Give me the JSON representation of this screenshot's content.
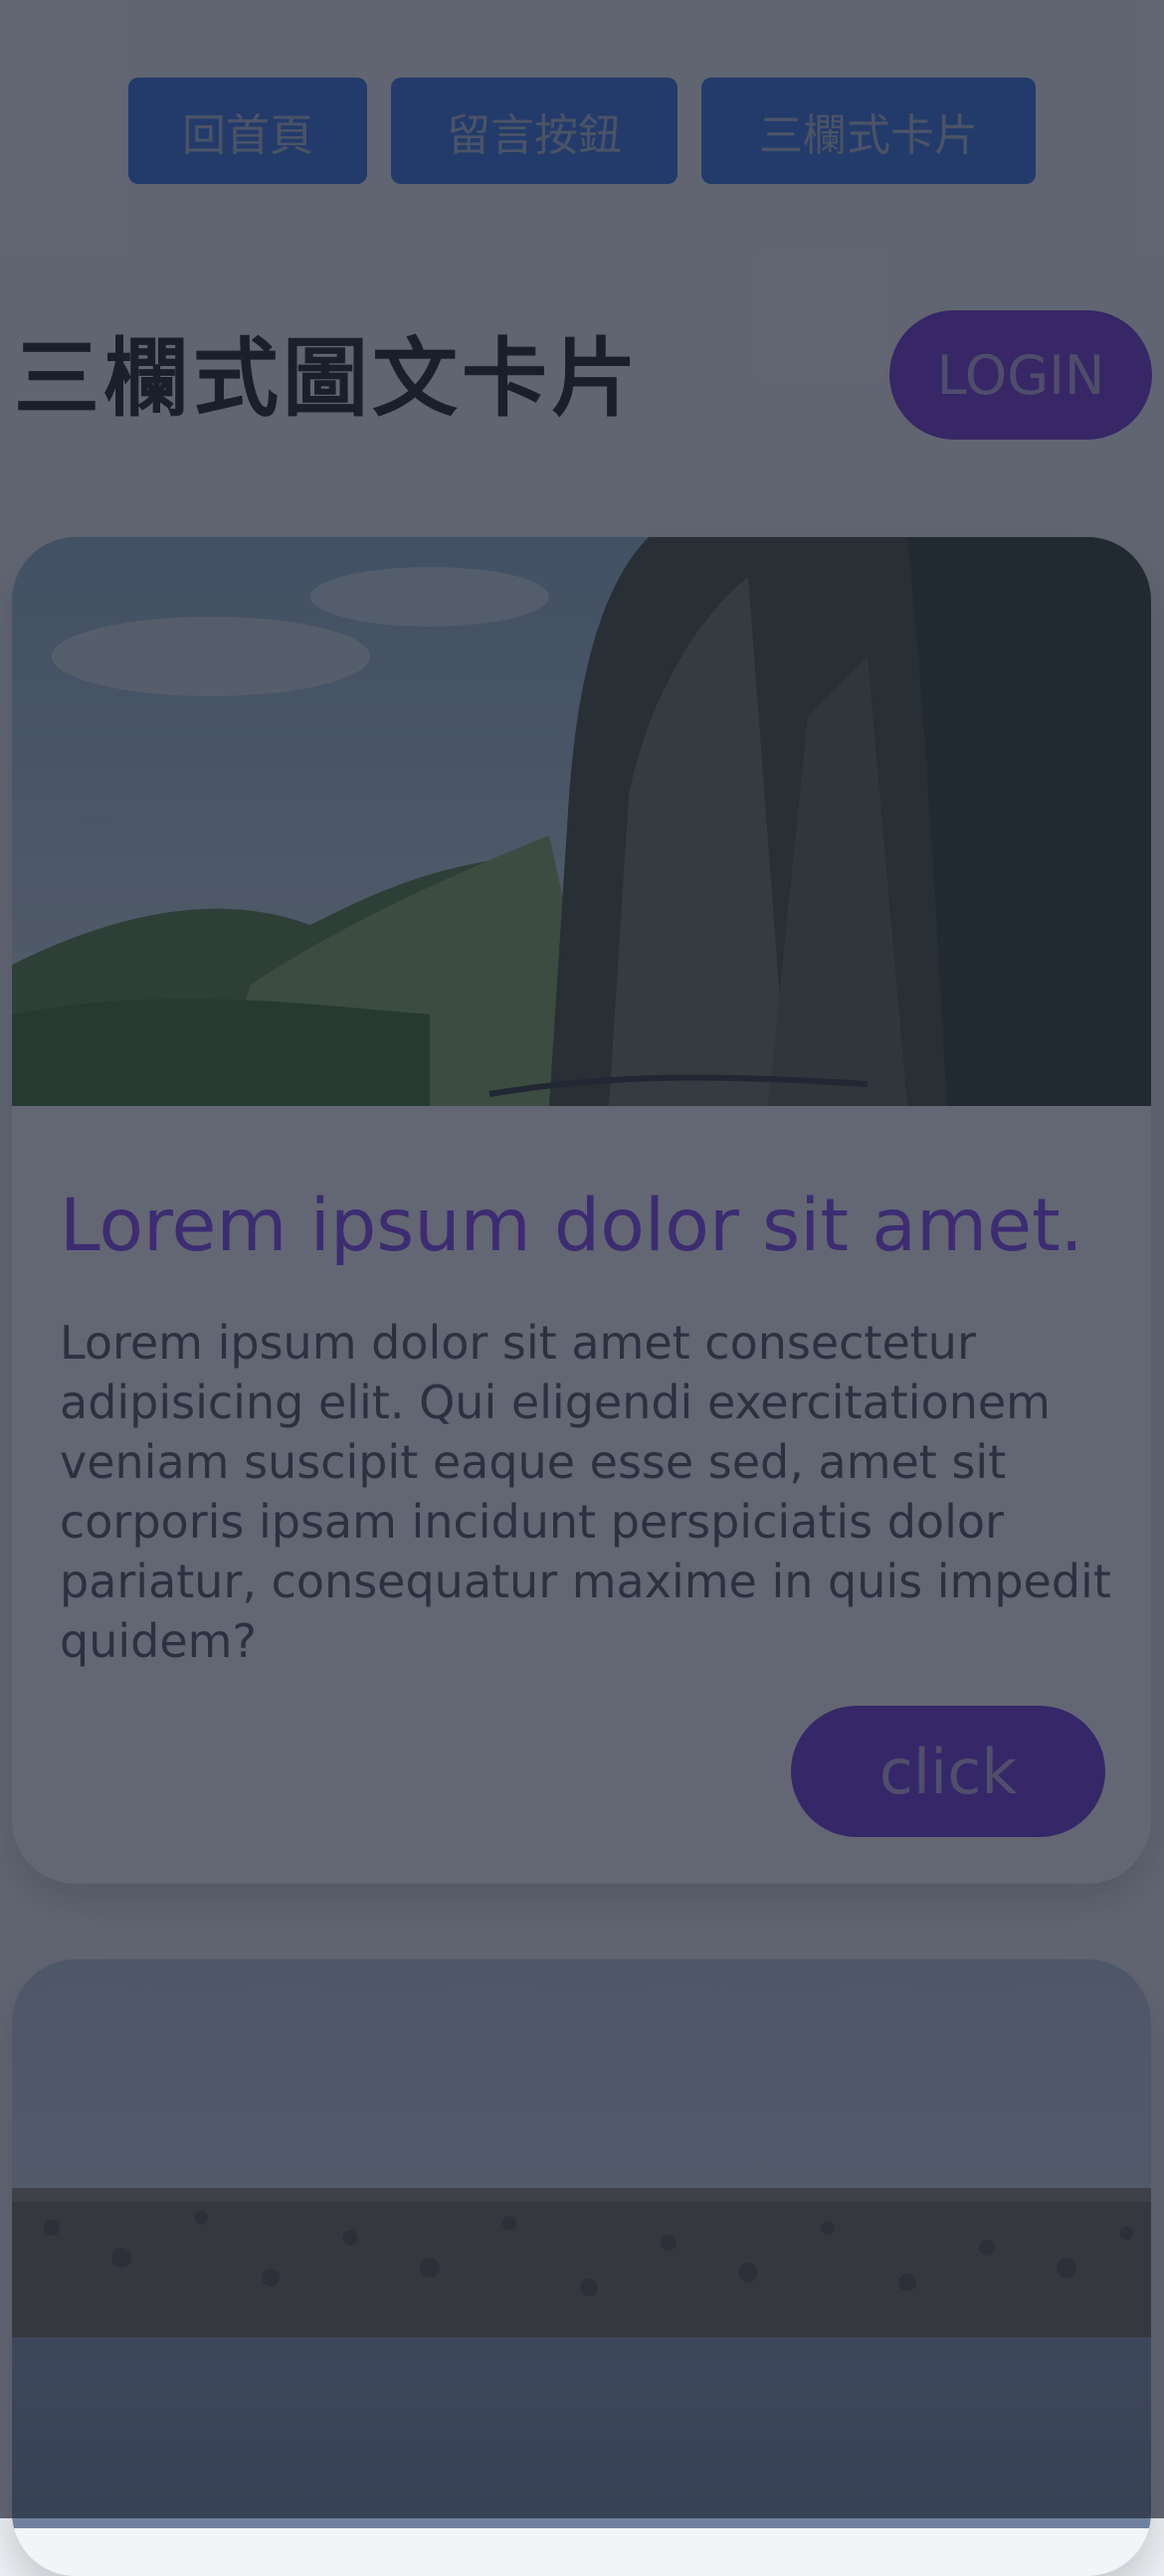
{
  "nav": {
    "items": [
      {
        "label": "回首頁"
      },
      {
        "label": "留言按鈕"
      },
      {
        "label": "三欄式卡片"
      }
    ]
  },
  "header": {
    "title": "三欄式圖文卡片",
    "login_label": "LOGIN"
  },
  "cards": [
    {
      "image": "mountain-cliff-landscape",
      "title": "Lorem ipsum dolor sit amet.",
      "text": "Lorem ipsum dolor sit amet consectetur adipisicing elit. Qui eligendi exercitationem veniam suscipit eaque esse sed, amet sit corporis ipsam incidunt perspiciatis dolor pariatur, consequatur maxime in quis impedit quidem?",
      "button_label": "click"
    },
    {
      "image": "rocky-shore-water-landscape"
    }
  ],
  "colors": {
    "nav_button": "#2f6fe0",
    "login_button": "#6f2fd3",
    "card_title": "#7f3ef2",
    "card_button": "#6a2fd8",
    "overlay": "rgba(30,36,52,0.68)"
  }
}
